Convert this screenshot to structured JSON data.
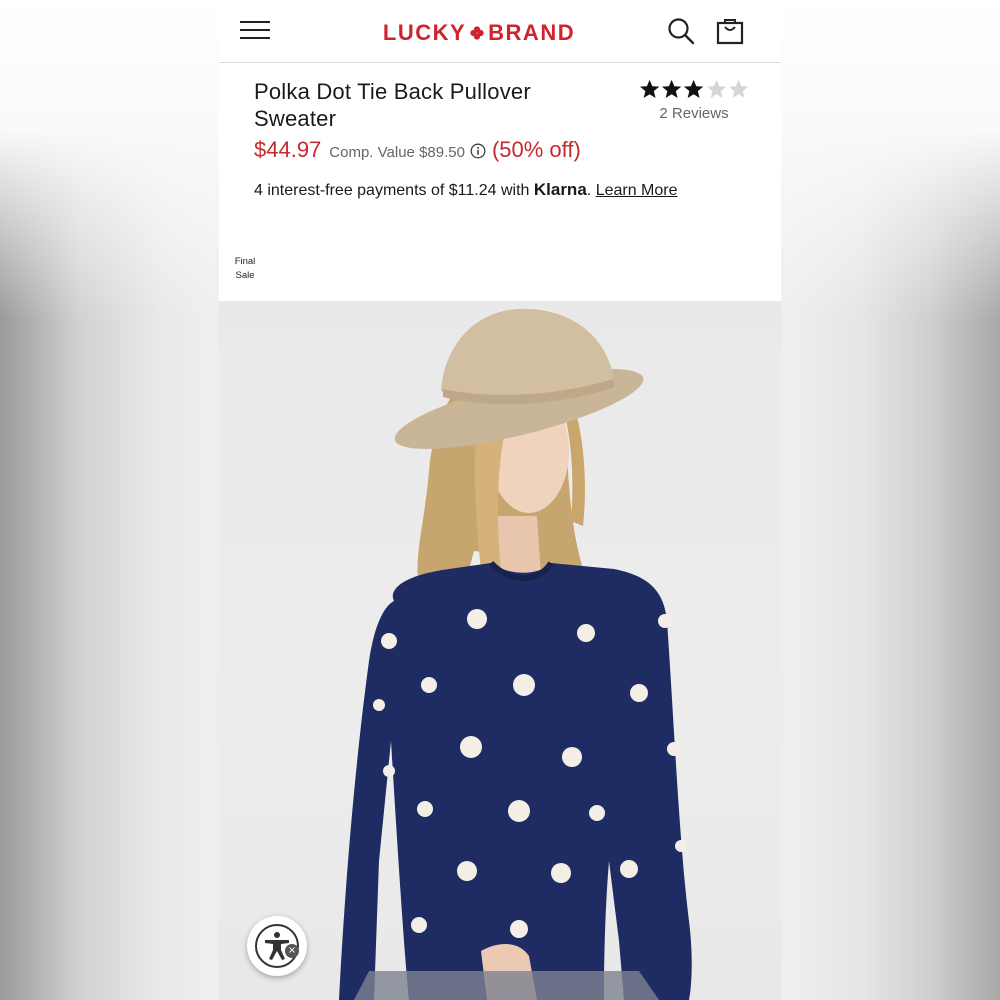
{
  "header": {
    "brand_left": "LUCKY",
    "brand_right": "BRAND",
    "brand_color": "#d0242c",
    "icons": [
      "menu-icon",
      "clover-icon",
      "search-icon",
      "bag-icon"
    ]
  },
  "product": {
    "title": "Polka Dot Tie Back Pullover Sweater",
    "rating": 3,
    "rating_max": 5,
    "reviews_label": "2 Reviews",
    "sale_price": "$44.97",
    "comp_value": "Comp. Value $89.50",
    "discount": "(50% off)",
    "price_color": "#c52a2f"
  },
  "klarna": {
    "text": "4 interest-free payments of $11.24 with ",
    "brand": "Klarna",
    "period": ".",
    "link": "Learn More"
  },
  "badge": {
    "line1": "Final",
    "line2": "Sale"
  },
  "accessibility": {
    "icon": "accessibility-icon",
    "close": "×"
  }
}
